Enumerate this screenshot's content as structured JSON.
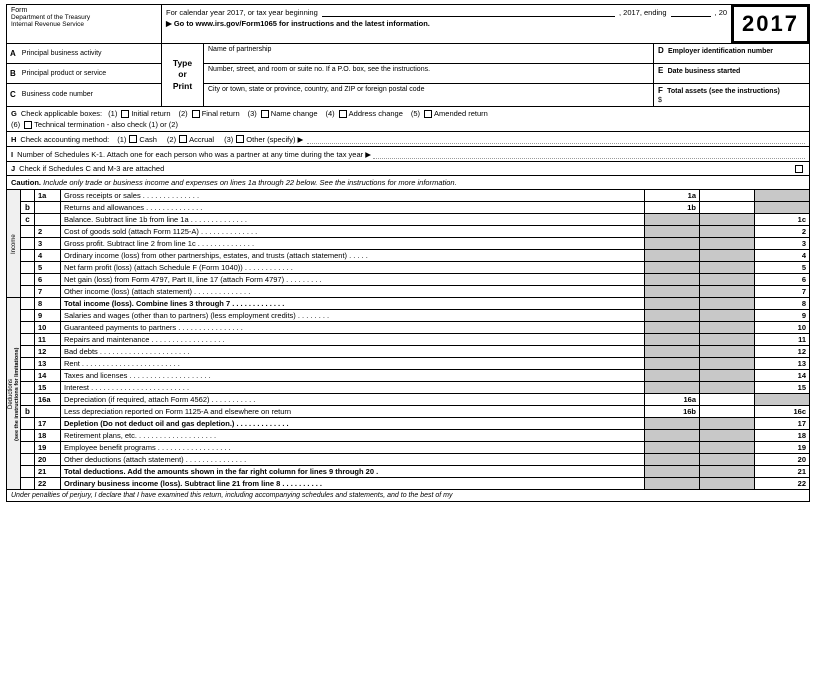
{
  "form": {
    "year": "2017",
    "year_label": "20",
    "calendar_year_text": "For calendar year 2017, or tax year beginning",
    "calendar_year_2017": ", 2017, ending",
    "comma_20": ", 20",
    "irs_link": "▶ Go to www.irs.gov/Form1065 for instructions and the latest information.",
    "dept_label": "Department of the Treasury\nInternal Revenue Service",
    "field_a_label": "A",
    "field_a_text": "Principal business activity",
    "field_b_label": "B",
    "field_b_text": "Principal product or service",
    "field_c_label": "C",
    "field_c_text": "Business code number",
    "type_or_print": "Type\nor\nPrint",
    "name_label": "Name of partnership",
    "number_street_label": "Number, street, and room or suite no. If a P.O. box, see the instructions.",
    "city_label": "City or town, state or province, country, and ZIP or foreign postal code",
    "field_d_label": "D",
    "field_d_text": "Employer identification number",
    "field_e_label": "E",
    "field_e_text": "Date business started",
    "field_f_label": "F",
    "field_f_text": "Total assets (see the instructions)",
    "field_f_dollar": "$",
    "g_label": "G",
    "g_text": "Check applicable boxes:",
    "g_items": [
      {
        "num": "(1)",
        "label": "Initial return"
      },
      {
        "num": "(2)",
        "label": "Final return"
      },
      {
        "num": "(3)",
        "label": "Name change"
      },
      {
        "num": "(4)",
        "label": "Address change"
      },
      {
        "num": "(5)",
        "label": "Amended return"
      },
      {
        "num": "(6)",
        "label": "Technical termination - also check (1) or (2)"
      }
    ],
    "h_label": "H",
    "h_text": "Check accounting method:",
    "h_items": [
      {
        "num": "(1)",
        "label": "Cash"
      },
      {
        "num": "(2)",
        "label": "Accrual"
      },
      {
        "num": "(3)",
        "label": "Other (specify) ▶"
      }
    ],
    "i_label": "I",
    "i_text": "Number of Schedules K-1. Attach one for each person who was a partner at any time during the tax year ▶",
    "j_label": "J",
    "j_text": "Check if Schedules C and M-3 are attached",
    "caution_text": "Caution. Include only trade or business income and expenses on lines 1a through 22 below. See the instructions for more information.",
    "income_label": "Income",
    "deductions_label": "Deductions",
    "deductions_note": "(see the instructions for limitations)",
    "lines": [
      {
        "num": "1a",
        "sub": "",
        "desc": "Gross receipts or sales . . . . . . . . . . . . . .",
        "col1": "1a",
        "col2": "",
        "col3": "",
        "shaded1": false,
        "shaded2": false,
        "shaded3": true,
        "bold": false
      },
      {
        "num": "",
        "sub": "b",
        "desc": "Returns and allowances . . . . . . . . . . . . . .",
        "col1": "1b",
        "col2": "",
        "col3": "",
        "shaded1": false,
        "shaded2": false,
        "shaded3": true,
        "bold": false
      },
      {
        "num": "",
        "sub": "c",
        "desc": "Balance. Subtract line 1b from line 1a . . . . . . . . . . . . . .",
        "col1": "",
        "col2": "",
        "col3": "1c",
        "shaded1": true,
        "shaded2": true,
        "shaded3": false,
        "bold": false
      },
      {
        "num": "2",
        "sub": "",
        "desc": "Cost of goods sold (attach Form 1125-A) . . . . . . . . . . . . . .",
        "col1": "",
        "col2": "",
        "col3": "2",
        "shaded1": true,
        "shaded2": true,
        "shaded3": false,
        "bold": false
      },
      {
        "num": "3",
        "sub": "",
        "desc": "Gross profit. Subtract line 2 from line 1c . . . . . . . . . . . . . .",
        "col1": "",
        "col2": "",
        "col3": "3",
        "shaded1": true,
        "shaded2": true,
        "shaded3": false,
        "bold": false
      },
      {
        "num": "4",
        "sub": "",
        "desc": "Ordinary income (loss) from other partnerships, estates, and trusts (attach statement) . . . . .",
        "col1": "",
        "col2": "",
        "col3": "4",
        "shaded1": true,
        "shaded2": true,
        "shaded3": false,
        "bold": false
      },
      {
        "num": "5",
        "sub": "",
        "desc": "Net farm profit (loss) (attach Schedule F (Form 1040)) . . . . . . . . . . . .",
        "col1": "",
        "col2": "",
        "col3": "5",
        "shaded1": true,
        "shaded2": true,
        "shaded3": false,
        "bold": false
      },
      {
        "num": "6",
        "sub": "",
        "desc": "Net gain (loss) from Form 4797, Part II, line 17 (attach Form 4797) . . . . . . . . .",
        "col1": "",
        "col2": "",
        "col3": "6",
        "shaded1": true,
        "shaded2": true,
        "shaded3": false,
        "bold": false
      },
      {
        "num": "7",
        "sub": "",
        "desc": "Other income (loss) (attach statement) . . . . . . . . . . . . . .",
        "col1": "",
        "col2": "",
        "col3": "7",
        "shaded1": true,
        "shaded2": true,
        "shaded3": false,
        "bold": false
      },
      {
        "num": "8",
        "sub": "",
        "desc": "Total income (loss). Combine lines 3 through 7 . . . . . . . . . . . . .",
        "col1": "",
        "col2": "",
        "col3": "8",
        "shaded1": true,
        "shaded2": true,
        "shaded3": false,
        "bold": true
      },
      {
        "num": "9",
        "sub": "",
        "desc": "Salaries and wages (other than to partners) (less employment credits) . . . . . . . .",
        "col1": "",
        "col2": "",
        "col3": "9",
        "shaded1": true,
        "shaded2": true,
        "shaded3": false,
        "bold": false
      },
      {
        "num": "10",
        "sub": "",
        "desc": "Guaranteed payments to partners . . . . . . . . . . . . . . . .",
        "col1": "",
        "col2": "",
        "col3": "10",
        "shaded1": true,
        "shaded2": true,
        "shaded3": false,
        "bold": false
      },
      {
        "num": "11",
        "sub": "",
        "desc": "Repairs and maintenance . . . . . . . . . . . . . . . . . .",
        "col1": "",
        "col2": "",
        "col3": "11",
        "shaded1": true,
        "shaded2": true,
        "shaded3": false,
        "bold": false
      },
      {
        "num": "12",
        "sub": "",
        "desc": "Bad debts . . . . . . . . . . . . . . . . . . . . . .",
        "col1": "",
        "col2": "",
        "col3": "12",
        "shaded1": true,
        "shaded2": true,
        "shaded3": false,
        "bold": false
      },
      {
        "num": "13",
        "sub": "",
        "desc": "Rent . . . . . . . . . . . . . . . . . . . . . . . .",
        "col1": "",
        "col2": "",
        "col3": "13",
        "shaded1": true,
        "shaded2": true,
        "shaded3": false,
        "bold": false
      },
      {
        "num": "14",
        "sub": "",
        "desc": "Taxes and licenses . . . . . . . . . . . . . . . . . . . .",
        "col1": "",
        "col2": "",
        "col3": "14",
        "shaded1": true,
        "shaded2": true,
        "shaded3": false,
        "bold": false
      },
      {
        "num": "15",
        "sub": "",
        "desc": "Interest . . . . . . . . . . . . . . . . . . . . . . . .",
        "col1": "",
        "col2": "",
        "col3": "15",
        "shaded1": true,
        "shaded2": true,
        "shaded3": false,
        "bold": false
      },
      {
        "num": "16a",
        "sub": "",
        "desc": "Depreciation (if required, attach Form 4562) . . . . . . . . . . .",
        "col1": "16a",
        "col2": "",
        "col3": "",
        "shaded1": false,
        "shaded2": false,
        "shaded3": true,
        "bold": false
      },
      {
        "num": "",
        "sub": "b",
        "desc": "Less depreciation reported on Form 1125-A and elsewhere on return",
        "col1": "16b",
        "col2": "",
        "col3": "16c",
        "shaded1": false,
        "shaded2": false,
        "shaded3": false,
        "bold": false
      },
      {
        "num": "17",
        "sub": "",
        "desc": "Depletion (Do not deduct oil and gas depletion.) . . . . . . . . . . . . .",
        "col1": "",
        "col2": "",
        "col3": "17",
        "shaded1": true,
        "shaded2": true,
        "shaded3": false,
        "bold": true
      },
      {
        "num": "18",
        "sub": "",
        "desc": "Retirement plans, etc. . . . . . . . . . . . . . . . . . . .",
        "col1": "",
        "col2": "",
        "col3": "18",
        "shaded1": true,
        "shaded2": true,
        "shaded3": false,
        "bold": false
      },
      {
        "num": "19",
        "sub": "",
        "desc": "Employee benefit programs . . . . . . . . . . . . . . . . . .",
        "col1": "",
        "col2": "",
        "col3": "19",
        "shaded1": true,
        "shaded2": true,
        "shaded3": false,
        "bold": false
      },
      {
        "num": "20",
        "sub": "",
        "desc": "Other deductions (attach statement) . . . . . . . . . . . . . . .",
        "col1": "",
        "col2": "",
        "col3": "20",
        "shaded1": true,
        "shaded2": true,
        "shaded3": false,
        "bold": false
      },
      {
        "num": "21",
        "sub": "",
        "desc": "Total deductions. Add the amounts shown in the far right column for lines 9 through 20 .",
        "col1": "",
        "col2": "",
        "col3": "21",
        "shaded1": true,
        "shaded2": true,
        "shaded3": false,
        "bold": true
      },
      {
        "num": "22",
        "sub": "",
        "desc": "Ordinary business income (loss). Subtract line 21 from line 8 . . . . . . . . . .",
        "col1": "",
        "col2": "",
        "col3": "22",
        "shaded1": true,
        "shaded2": true,
        "shaded3": false,
        "bold": true
      }
    ],
    "footer_text": "Under penalties of perjury, I declare that I have examined this return, including accompanying schedules and statements, and to the best of my"
  }
}
